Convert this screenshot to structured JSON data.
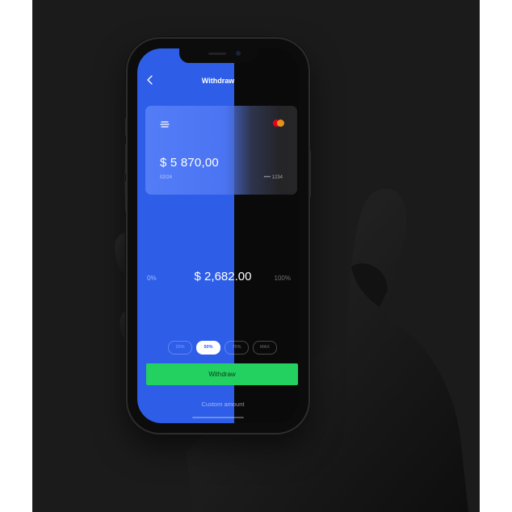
{
  "header": {
    "title": "Withdraw",
    "back_icon": "chevron-left-icon"
  },
  "card": {
    "balance": "$ 5 870,00",
    "expiry": "02/24",
    "number": "•••• 1234",
    "brand_icon": "mastercard-icon",
    "logo_icon": "stack-logo-icon"
  },
  "slider": {
    "min_label": "0%",
    "max_label": "100%",
    "amount": "$ 2,682.00",
    "fill_fraction": 0.6
  },
  "chips": [
    {
      "label": "25%",
      "active": false
    },
    {
      "label": "50%",
      "active": true
    },
    {
      "label": "75%",
      "active": false
    },
    {
      "label": "MAX",
      "active": false
    }
  ],
  "actions": {
    "withdraw_label": "Withdraw",
    "custom_amount_label": "Custom amount"
  },
  "colors": {
    "accent_blue": "#2e5ee8",
    "button_green": "#23d160"
  }
}
